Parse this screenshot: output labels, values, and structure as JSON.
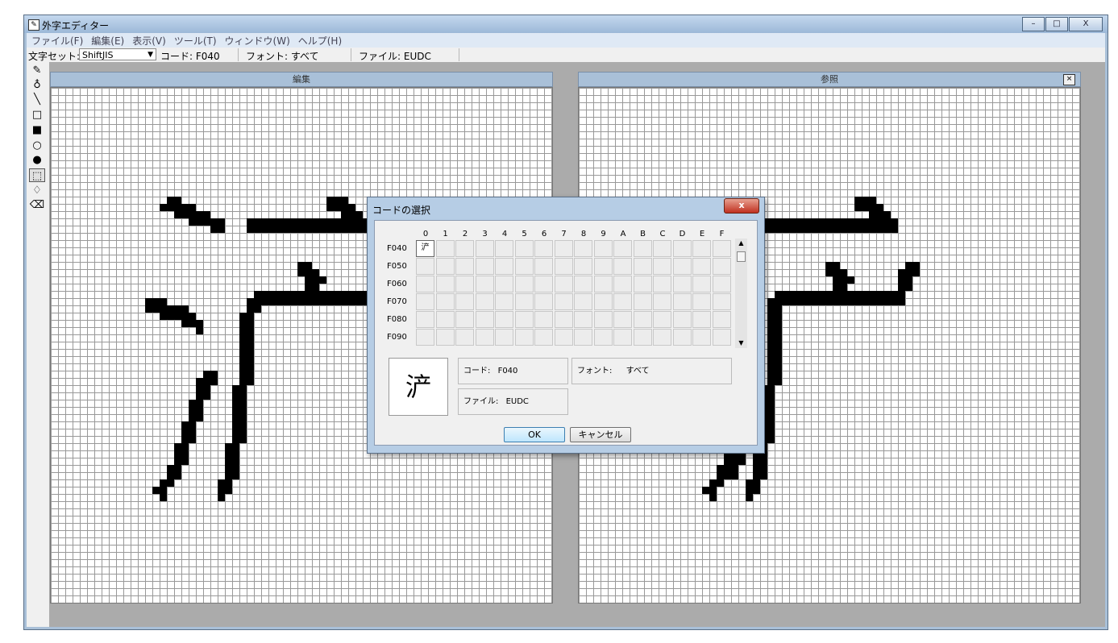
{
  "window": {
    "title": "外字エディター",
    "minimize": "–",
    "maximize": "□",
    "close": "X"
  },
  "menu": [
    "ファイル(F)",
    "編集(E)",
    "表示(V)",
    "ツール(T)",
    "ウィンドウ(W)",
    "ヘルプ(H)"
  ],
  "toolbar": {
    "charset_label": "文字セット:",
    "charset_value": "ShiftJIS",
    "code": "コード: F040",
    "font": "フォント: すべて",
    "file": "ファイル: EUDC"
  },
  "tools": [
    {
      "name": "pencil-tool",
      "glyph": "✎"
    },
    {
      "name": "brush-tool",
      "glyph": "♁"
    },
    {
      "name": "line-tool",
      "glyph": "╲"
    },
    {
      "name": "hollow-rectangle-tool",
      "glyph": "□"
    },
    {
      "name": "filled-rectangle-tool",
      "glyph": "■"
    },
    {
      "name": "hollow-ellipse-tool",
      "glyph": "○"
    },
    {
      "name": "filled-ellipse-tool",
      "glyph": "●"
    },
    {
      "name": "rectangular-select-tool",
      "glyph": "⬚"
    },
    {
      "name": "freeform-select-tool",
      "glyph": "♢"
    },
    {
      "name": "eraser-tool",
      "glyph": "⌫"
    }
  ],
  "edit_panel": {
    "title": "編集"
  },
  "reference_panel": {
    "title": "参照",
    "close": "×"
  },
  "dialog": {
    "title": "コードの選択",
    "close": "x",
    "columns": [
      "0",
      "1",
      "2",
      "3",
      "4",
      "5",
      "6",
      "7",
      "8",
      "9",
      "A",
      "B",
      "C",
      "D",
      "E",
      "F"
    ],
    "rows": [
      "F040",
      "F050",
      "F060",
      "F070",
      "F080",
      "F090"
    ],
    "selected_char": "浐",
    "code_label": "コード:",
    "code_value": "F040",
    "font_label": "フォント:",
    "font_value": "すべて",
    "file_label": "ファイル:",
    "file_value": "EUDC",
    "ok": "OK",
    "cancel": "キャンセル",
    "scroll_up": "▲",
    "scroll_down": "▼"
  }
}
